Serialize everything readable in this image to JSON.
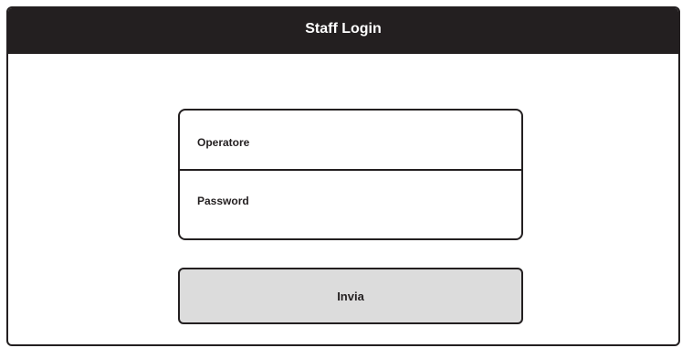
{
  "window": {
    "title": "Staff Login"
  },
  "form": {
    "operator_label": "Operatore",
    "password_label": "Password",
    "submit_label": "Invia"
  },
  "colors": {
    "title_bar_background": "#231f20",
    "title_text": "#ffffff",
    "border": "#231f20",
    "button_background": "#dcdcdc"
  }
}
